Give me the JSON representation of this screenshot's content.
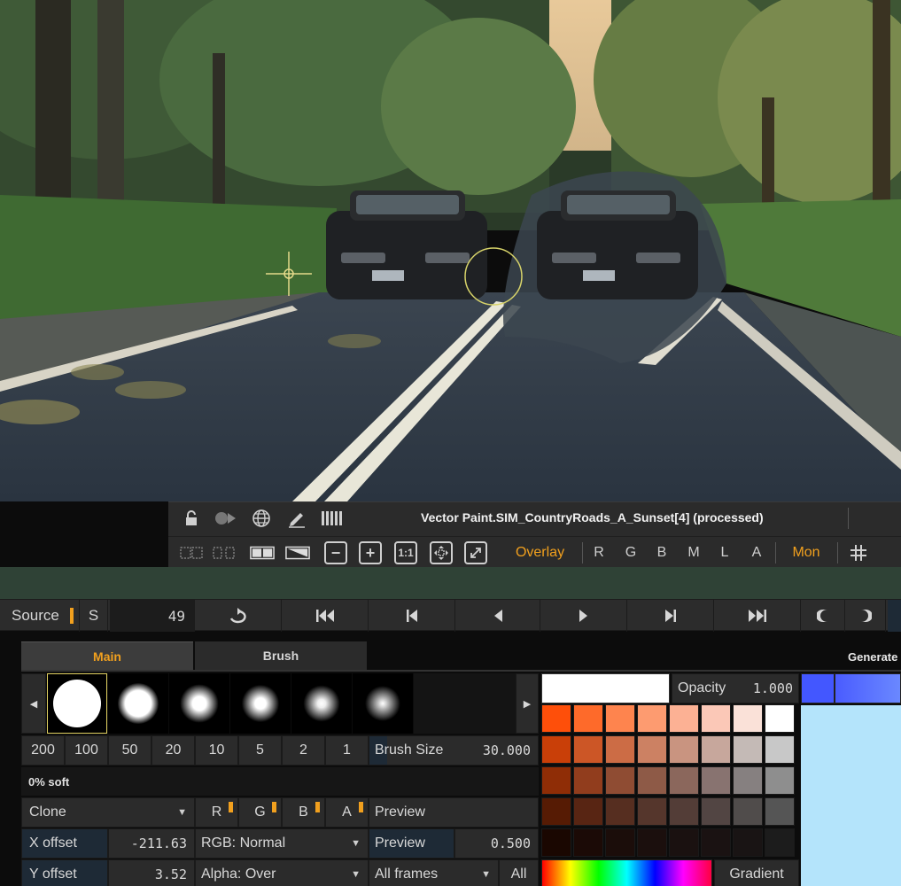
{
  "viewer": {
    "title": "Vector Paint.SIM_CountryRoads_A_Sunset[4] (processed)",
    "row1_icons": [
      "lock-icon",
      "record-icon",
      "globe-icon",
      "pencil-icon",
      "barcode-icon"
    ],
    "compare_icons": [
      "wipe-film-icon",
      "stacked-film-icon",
      "side-by-side-icon",
      "split-wipe-icon"
    ],
    "zoom_icons": [
      "zoom-out-icon",
      "zoom-in-icon",
      "fit-1to1-icon",
      "fit-frame-icon",
      "fullscreen-icon"
    ],
    "zoom_1to1_label": "1:1",
    "overlay_label": "Overlay",
    "channels": [
      "R",
      "G",
      "B",
      "M",
      "L",
      "A"
    ],
    "mon_label": "Mon",
    "grid_icon": "grid-icon",
    "accent_color": "#f1a01e"
  },
  "timeline": {
    "source_label": "Source",
    "s_label": "S",
    "frame": "49",
    "buttons": [
      "loop-icon",
      "go-to-start-icon",
      "previous-key-icon",
      "play-reverse-icon",
      "play-forward-icon",
      "next-key-icon",
      "go-to-end-icon",
      "in-point-icon",
      "out-point-icon"
    ]
  },
  "panel": {
    "tabs": [
      "Main",
      "Brush"
    ],
    "generate_label": "Generate",
    "brush_presets": [
      "hard",
      "soft-1",
      "soft-2",
      "soft-3",
      "soft-4",
      "soft-5"
    ],
    "size_presets": [
      "200",
      "100",
      "50",
      "20",
      "10",
      "5",
      "2",
      "1"
    ],
    "brush_size_label": "Brush Size",
    "brush_size_value": "30.000",
    "softness_label": "0% soft",
    "mode_label": "Clone",
    "channel_toggles": [
      "R",
      "G",
      "B",
      "A"
    ],
    "preview_label": "Preview",
    "x_offset_label": "X offset",
    "x_offset_value": "-211.63",
    "y_offset_label": "Y offset",
    "y_offset_value": "3.52",
    "rgb_mode": "RGB: Normal",
    "alpha_mode": "Alpha: Over",
    "preview2_label": "Preview",
    "preview_value": "0.500",
    "frames_mode": "All frames",
    "all_label": "All",
    "opacity_label": "Opacity",
    "opacity_value": "1.000",
    "gradient_label": "Gradient",
    "current_color": "#ffffff",
    "palette": [
      [
        "#fe4f0a",
        "#fe6a2a",
        "#fe844e",
        "#fd9b70",
        "#fcb194",
        "#fbc8b7",
        "#fae1d8",
        "#ffffff"
      ],
      [
        "#c93f08",
        "#cc5626",
        "#cc6c45",
        "#cc8163",
        "#c99480",
        "#c7a79c",
        "#c4bab6",
        "#c8c8c8"
      ],
      [
        "#8f2d06",
        "#913d1d",
        "#8f4c33",
        "#8e5a47",
        "#8b675c",
        "#887370",
        "#868080",
        "#8e8e8e"
      ],
      [
        "#561b04",
        "#582513",
        "#562e20",
        "#55362c",
        "#533d37",
        "#524543",
        "#504c4b",
        "#555555"
      ],
      [
        "#1a0701",
        "#1b0a06",
        "#1b0d0a",
        "#1b0f0d",
        "#1a1110",
        "#1a1212",
        "#191414",
        "#1c1c1c"
      ]
    ]
  }
}
